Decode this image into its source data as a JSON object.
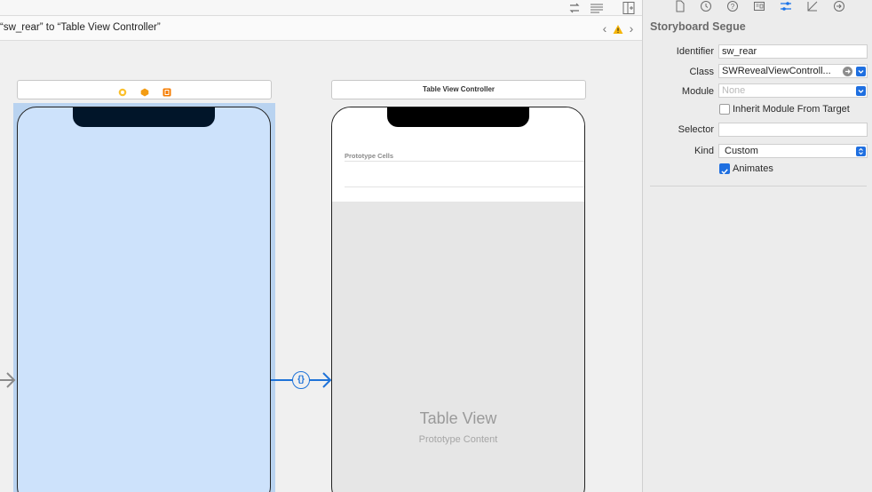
{
  "jumpbar": {
    "breadcrumb": "“sw_rear” to “Table View Controller”"
  },
  "scenes": {
    "rear": {
      "title": ""
    },
    "table": {
      "title": "Table View Controller",
      "prototype_cells_label": "Prototype Cells",
      "table_view_title": "Table View",
      "table_view_subtitle": "Prototype Content"
    }
  },
  "inspector": {
    "section_title": "Storyboard Segue",
    "identifier": {
      "label": "Identifier",
      "value": "sw_rear"
    },
    "class": {
      "label": "Class",
      "value": "SWRevealViewControll..."
    },
    "module": {
      "label": "Module",
      "placeholder": "None"
    },
    "inherit": {
      "label": "Inherit Module From Target",
      "checked": false
    },
    "selector": {
      "label": "Selector",
      "value": ""
    },
    "kind": {
      "label": "Kind",
      "value": "Custom"
    },
    "animates": {
      "label": "Animates",
      "checked": true
    }
  },
  "icons": {
    "toolbar": [
      "swap-arrows-icon",
      "align-lines-icon",
      "add-editor-icon"
    ],
    "inspector_tabs": [
      "file-icon",
      "history-icon",
      "help-icon",
      "identity-icon",
      "attributes-icon",
      "size-icon",
      "connections-icon"
    ],
    "scene_dock": [
      "view-controller-icon",
      "first-responder-icon",
      "exit-icon"
    ]
  },
  "colors": {
    "accent": "#1f73d8",
    "selection": "#b9d3f0",
    "rear_view_background": "#cde2fb",
    "notch": "#011529",
    "warning": "#f5b50a"
  }
}
